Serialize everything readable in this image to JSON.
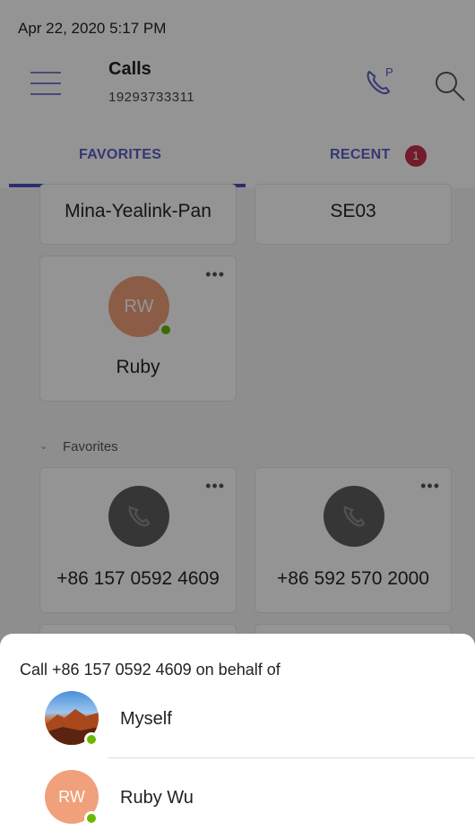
{
  "status_bar": {
    "datetime": "Apr 22, 2020  5:17 PM"
  },
  "header": {
    "title": "Calls",
    "phone_number": "19293733311",
    "icons": [
      "menu-icon",
      "call-park-icon",
      "search-icon"
    ]
  },
  "tabs": [
    {
      "label": "FAVORITES",
      "active": true
    },
    {
      "label": "RECENT",
      "badge": "1"
    }
  ],
  "favorites_top": [
    {
      "name": "Mina-Yealink-Pan"
    },
    {
      "name": "SE03"
    },
    {
      "name": "Ruby",
      "initials": "RW",
      "more": "•••"
    }
  ],
  "favorites_section": {
    "label": "Favorites",
    "items": [
      {
        "name": "+86 157 0592 4609",
        "more": "•••"
      },
      {
        "name": "+86 592 570 2000",
        "more": "•••"
      }
    ]
  },
  "sheet": {
    "title": "Call +86 157 0592 4609 on behalf of",
    "options": [
      {
        "label": "Myself",
        "avatar": "photo"
      },
      {
        "label": "Ruby Wu",
        "initials": "RW"
      }
    ]
  },
  "colors": {
    "accent": "#5b5fc7",
    "badge": "#c4314b",
    "presence": "#6bb700",
    "avatar_rw": "#f0a07a"
  }
}
